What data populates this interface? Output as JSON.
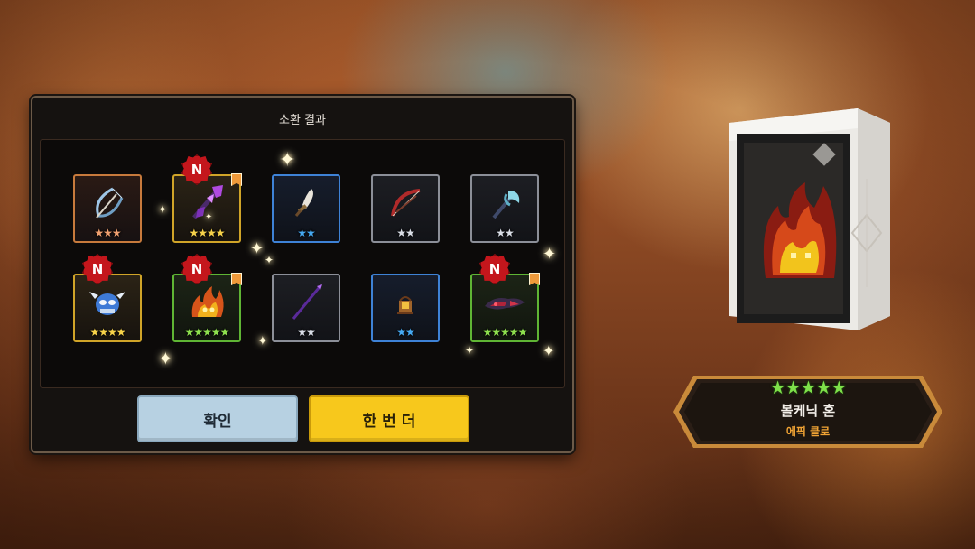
{
  "dialog": {
    "title": "소환 결과",
    "confirm_label": "확인",
    "again_label": "한 번 더",
    "new_badge_label": "N"
  },
  "results": [
    {
      "item": "ice-bow-icon",
      "stars": 3,
      "frame": "orange",
      "is_new": false
    },
    {
      "item": "purple-crystal-staff-icon",
      "stars": 4,
      "frame": "gold",
      "is_new": true
    },
    {
      "item": "dagger-icon",
      "stars": 2,
      "frame": "blue",
      "is_new": false
    },
    {
      "item": "red-bow-icon",
      "stars": 2,
      "frame": "gray",
      "is_new": false
    },
    {
      "item": "axe-icon",
      "stars": 2,
      "frame": "gray",
      "is_new": false
    },
    {
      "item": "frost-mask-icon",
      "stars": 4,
      "frame": "gold",
      "is_new": true
    },
    {
      "item": "flame-soul-icon",
      "stars": 5,
      "frame": "green",
      "is_new": true
    },
    {
      "item": "purple-spear-icon",
      "stars": 2,
      "frame": "gray",
      "is_new": false
    },
    {
      "item": "lantern-icon",
      "stars": 2,
      "frame": "blue",
      "is_new": false
    },
    {
      "item": "dark-claw-icon",
      "stars": 5,
      "frame": "green",
      "is_new": true
    }
  ],
  "star_glyph": "★",
  "featured": {
    "stars": 5,
    "name": "볼케닉 혼",
    "grade": "에픽 클로",
    "item_icon": "flame-soul-icon"
  },
  "colors": {
    "confirm_button": "#b7d1e2",
    "again_button": "#f7c81c",
    "new_badge": "#c4161c",
    "grade_text": "#f0a334",
    "five_star": "#8ee04e"
  }
}
